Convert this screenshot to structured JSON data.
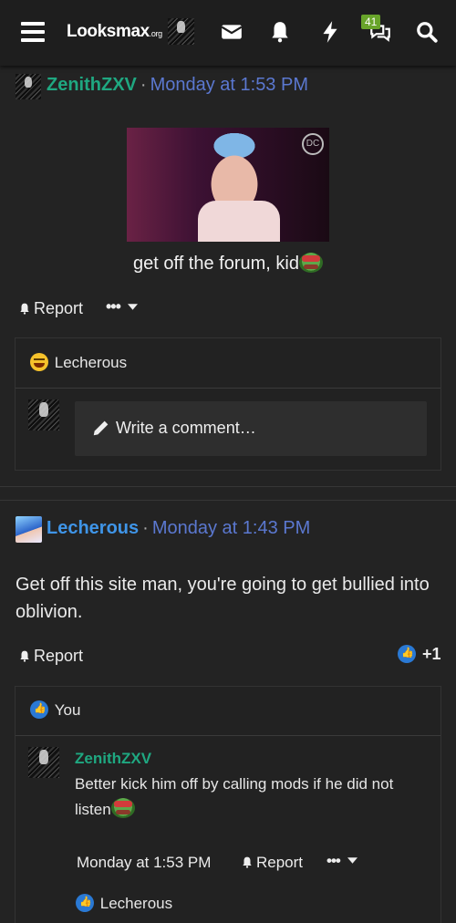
{
  "header": {
    "logo_main": "Looksmax",
    "logo_suffix": ".org",
    "alerts_badge": "41"
  },
  "post1": {
    "author": "ZenithZXV",
    "time": "Monday at 1:53 PM",
    "caption": "get off the forum, kid",
    "report_label": "Report",
    "reaction_user": "Lecherous",
    "comment_placeholder": "Write a comment…"
  },
  "post2": {
    "author": "Lecherous",
    "time": "Monday at 1:43 PM",
    "body": "Get off this site man, you're going to get bullied into oblivion.",
    "report_label": "Report",
    "reaction_count": "+1",
    "reaction_user": "You",
    "reply": {
      "author": "ZenithZXV",
      "text": "Better kick him off by calling mods if he did not listen",
      "time": "Monday at 1:53 PM",
      "report_label": "Report",
      "reaction_user": "Lecherous"
    }
  },
  "colors": {
    "background": "#232323",
    "username_green": "#1fa881",
    "username_blue": "#3f95e8",
    "timestamp": "#5b78d0",
    "badge": "#68a42a",
    "like": "#2a79d4"
  }
}
